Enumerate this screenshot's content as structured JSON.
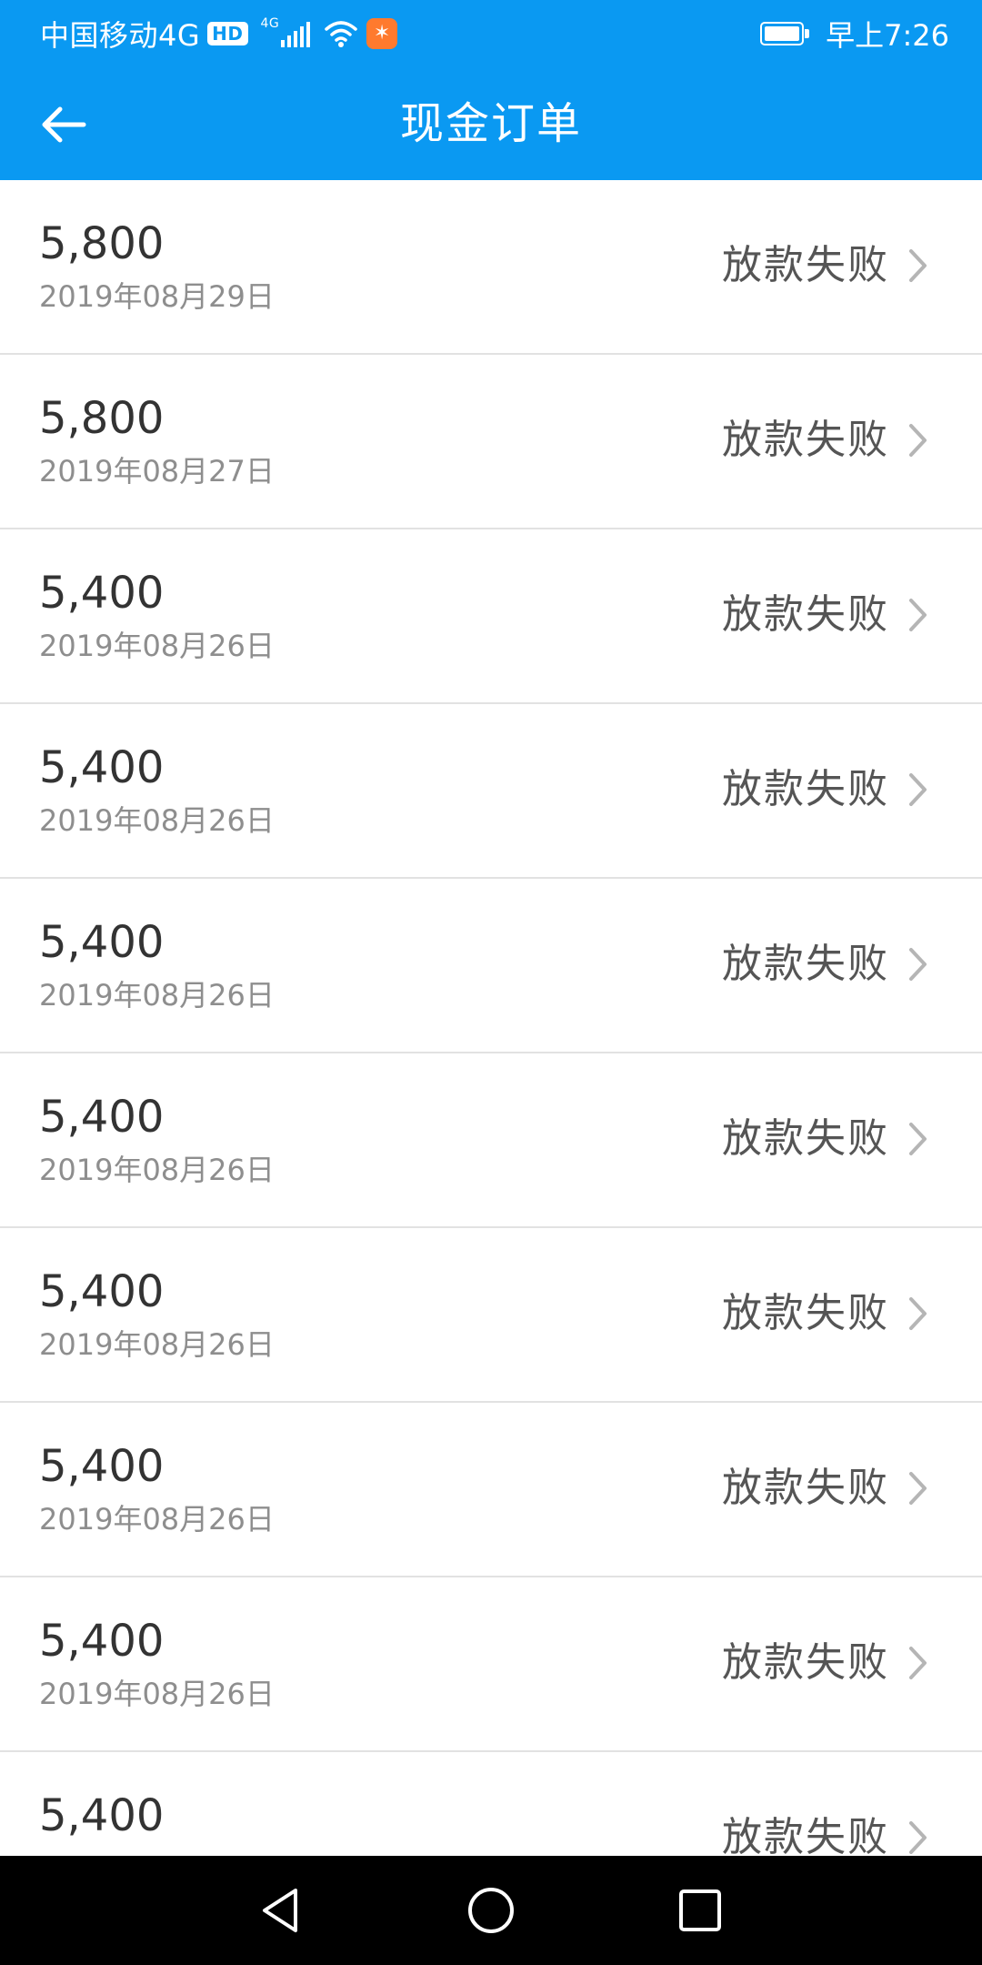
{
  "status_bar": {
    "carrier": "中国移动4G",
    "hd_badge": "HD",
    "network_type": "4G",
    "time": "早上7:26",
    "battery_level": 1.0
  },
  "app_bar": {
    "title": "现金订单",
    "back_icon": "arrow-left-icon"
  },
  "orders": [
    {
      "amount": "5,800",
      "date": "2019年08月29日",
      "status": "放款失败"
    },
    {
      "amount": "5,800",
      "date": "2019年08月27日",
      "status": "放款失败"
    },
    {
      "amount": "5,400",
      "date": "2019年08月26日",
      "status": "放款失败"
    },
    {
      "amount": "5,400",
      "date": "2019年08月26日",
      "status": "放款失败"
    },
    {
      "amount": "5,400",
      "date": "2019年08月26日",
      "status": "放款失败"
    },
    {
      "amount": "5,400",
      "date": "2019年08月26日",
      "status": "放款失败"
    },
    {
      "amount": "5,400",
      "date": "2019年08月26日",
      "status": "放款失败"
    },
    {
      "amount": "5,400",
      "date": "2019年08月26日",
      "status": "放款失败"
    },
    {
      "amount": "5,400",
      "date": "2019年08月26日",
      "status": "放款失败"
    },
    {
      "amount": "5,400",
      "date": "",
      "status": "放款失败"
    }
  ],
  "nav_bar": {
    "icons": [
      "back-triangle-icon",
      "home-circle-icon",
      "recents-square-icon"
    ]
  },
  "colors": {
    "primary": "#0a99f2",
    "amount_text": "#333333",
    "date_text": "#8e8e8e",
    "status_text": "#555555",
    "divider": "#e2e2e2"
  }
}
